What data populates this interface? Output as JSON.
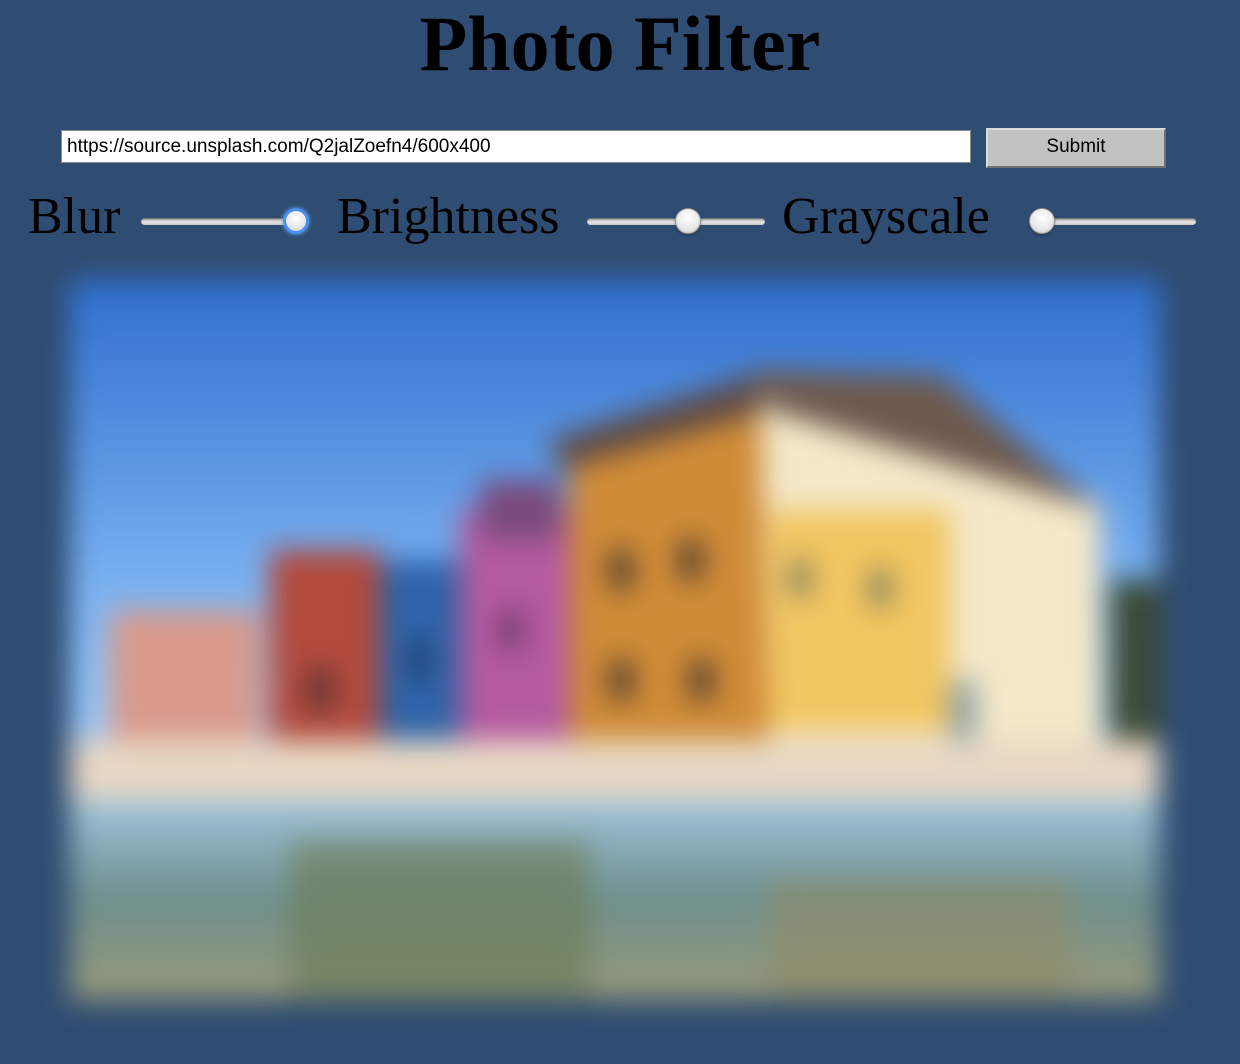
{
  "page": {
    "title": "Photo Filter"
  },
  "form": {
    "url_value": "https://source.unsplash.com/Q2jalZoefn4/600x400",
    "submit_label": "Submit"
  },
  "sliders": [
    {
      "label": "Blur",
      "value_fraction": 1.0
    },
    {
      "label": "Brightness",
      "value_fraction": 0.58
    },
    {
      "label": "Grayscale",
      "value_fraction": 0.0
    }
  ],
  "photo": {
    "subject": "colorful-houses-by-canal",
    "filter": "blurred"
  },
  "colors": {
    "background": "#2f4d72",
    "focus_ring": "#4a8ff0"
  }
}
